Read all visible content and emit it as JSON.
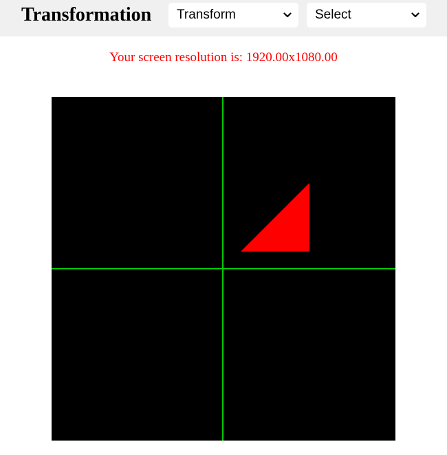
{
  "header": {
    "title": "Transformation",
    "transform_select": {
      "selected": "Transform"
    },
    "mode_select": {
      "selected": "Select"
    }
  },
  "resolution_text": "Your screen resolution is: 1920.00x1080.00",
  "canvas": {
    "background": "#000000",
    "axis_color": "#00cc00",
    "shape_color": "#ff0000",
    "shape": "triangle"
  }
}
